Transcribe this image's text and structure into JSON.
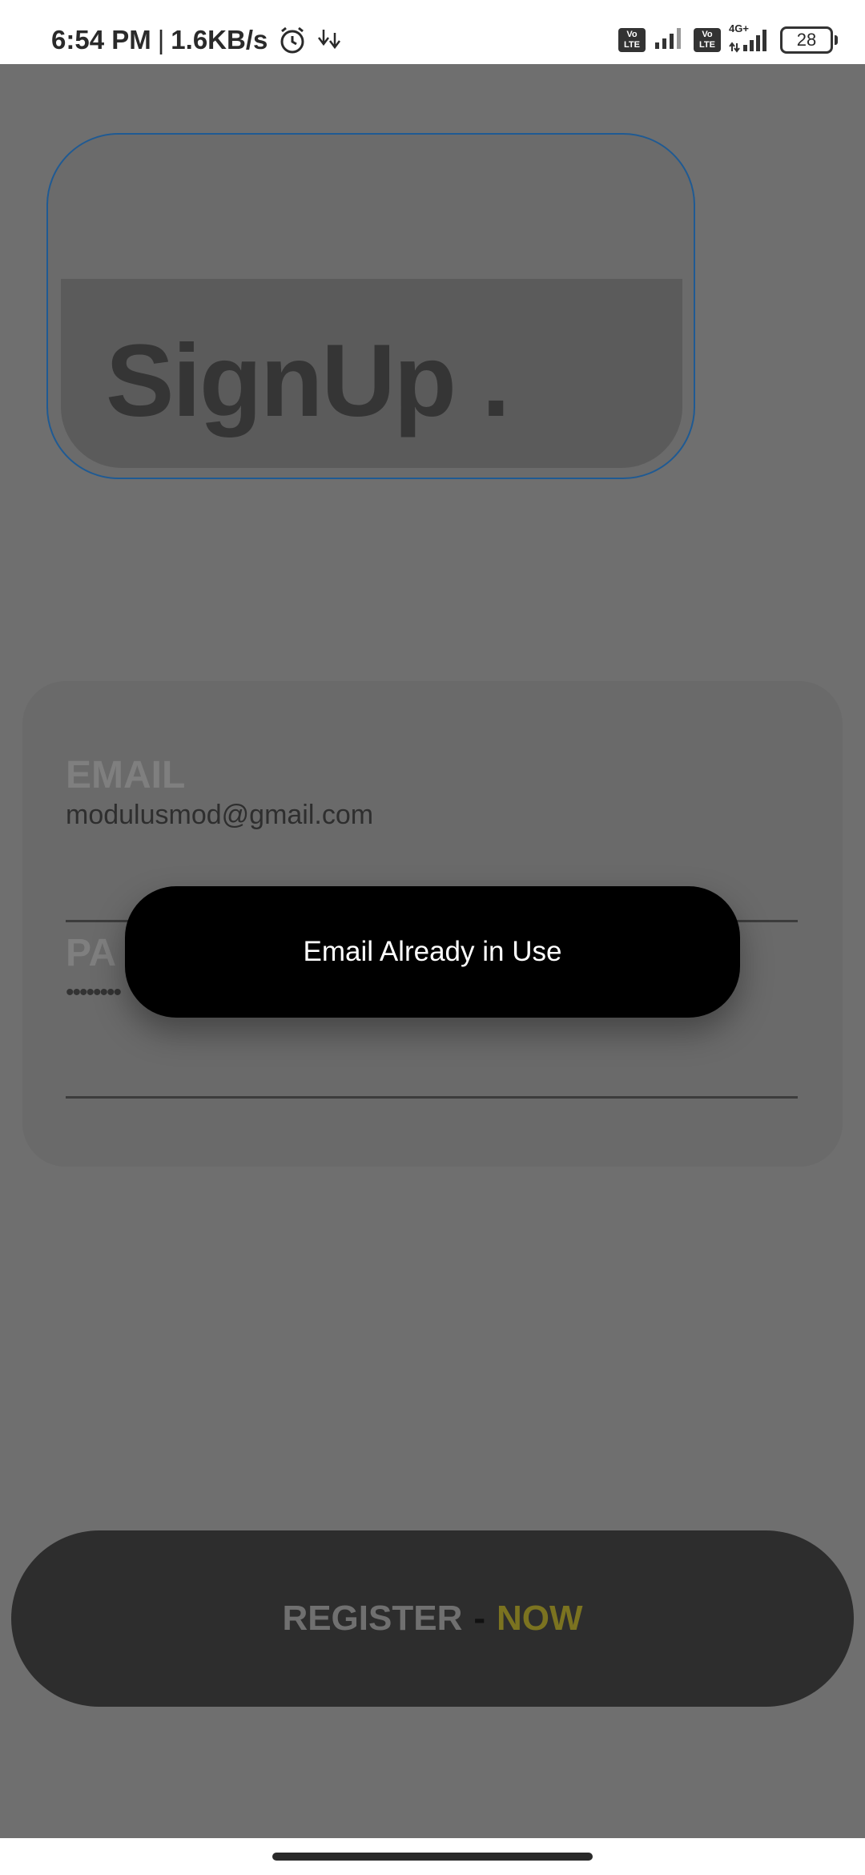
{
  "status_bar": {
    "time": "6:54 PM",
    "separator": "|",
    "net_speed": "1.6KB/s",
    "icons": [
      "alarm-icon",
      "download-icon",
      "volte-icon",
      "signal-icon",
      "volte-icon",
      "4g-signal-icon",
      "battery-icon"
    ],
    "volte_label": "Vo\nLTE",
    "network_type": "4G+",
    "battery_level": "28"
  },
  "logo": {
    "title": "SignUp ."
  },
  "form": {
    "email": {
      "label": "EMAIL",
      "value": "modulusmod@gmail.com"
    },
    "password": {
      "label": "PA",
      "value": "••••••••"
    }
  },
  "toast": {
    "message": "Email Already in Use"
  },
  "register_button": {
    "label_primary": "REGISTER",
    "separator": "-",
    "label_accent": "NOW"
  },
  "colors": {
    "overlay": "#6f6f6f",
    "card_border": "#1f5a93",
    "toast_bg": "#000000",
    "accent": "#7b7320"
  }
}
